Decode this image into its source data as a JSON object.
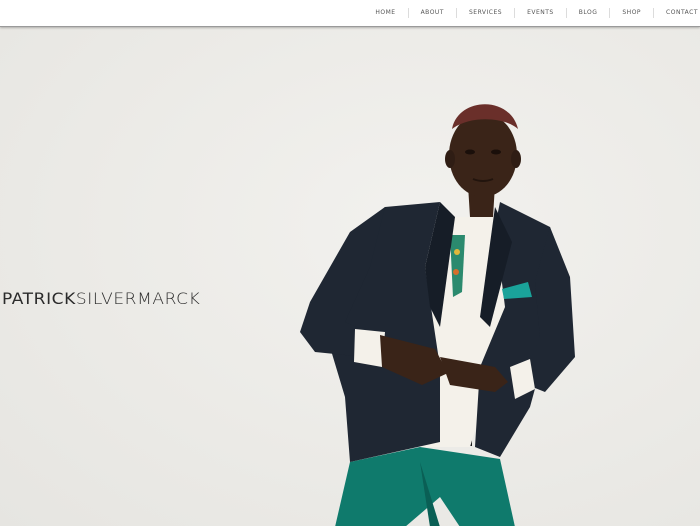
{
  "nav": {
    "items": [
      "HOME",
      "ABOUT",
      "SERVICES",
      "EVENTS",
      "BLOG",
      "SHOP",
      "CONTACT"
    ]
  },
  "hero": {
    "brand_first": "PATRICK",
    "brand_last": "SILVERMARCK"
  },
  "colors": {
    "background": "#ecebe7",
    "jacket": "#1f2733",
    "pants": "#0f7a6c",
    "pocket_square": "#1aa39a",
    "skin": "#3a2418"
  }
}
